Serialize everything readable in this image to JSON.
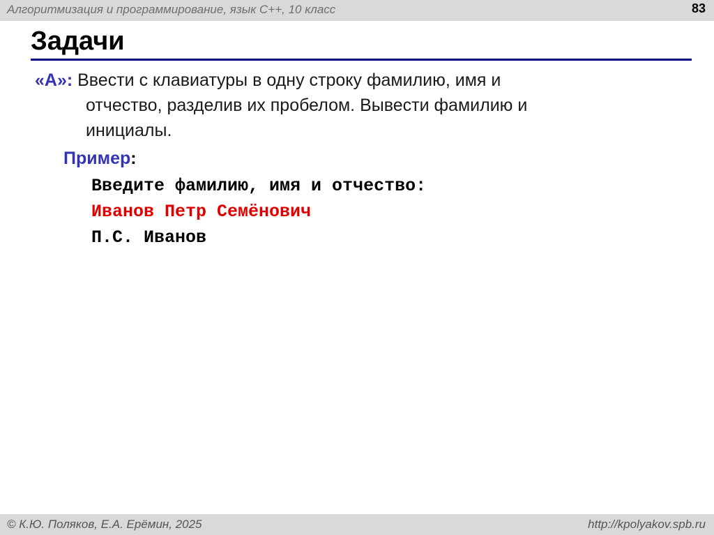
{
  "header": {
    "course_title": "Алгоритмизация и программирование, язык С++, 10 класс",
    "page_number": "83"
  },
  "slide": {
    "title": "Задачи",
    "task": {
      "label": "«A»:",
      "line1": " Ввести с клавиатуры в одну строку фамилию, имя и",
      "line2": "отчество, разделив их пробелом. Вывести фамилию и",
      "line3": "инициалы."
    },
    "example": {
      "label": "Пример",
      "colon": ":",
      "lines": {
        "prompt": "Введите фамилию, имя и отчество:",
        "input": "Иванов Петр Семёнович",
        "output": "П.С. Иванов"
      }
    }
  },
  "footer": {
    "authors": "© К.Ю. Поляков, Е.А. Ерёмин, 2025",
    "site": "http://kpolyakov.spb.ru"
  },
  "colors": {
    "accent": "#3333b3",
    "title_rule": "#000080",
    "input_text": "#e00000",
    "bar_background": "#d9d9d9"
  }
}
